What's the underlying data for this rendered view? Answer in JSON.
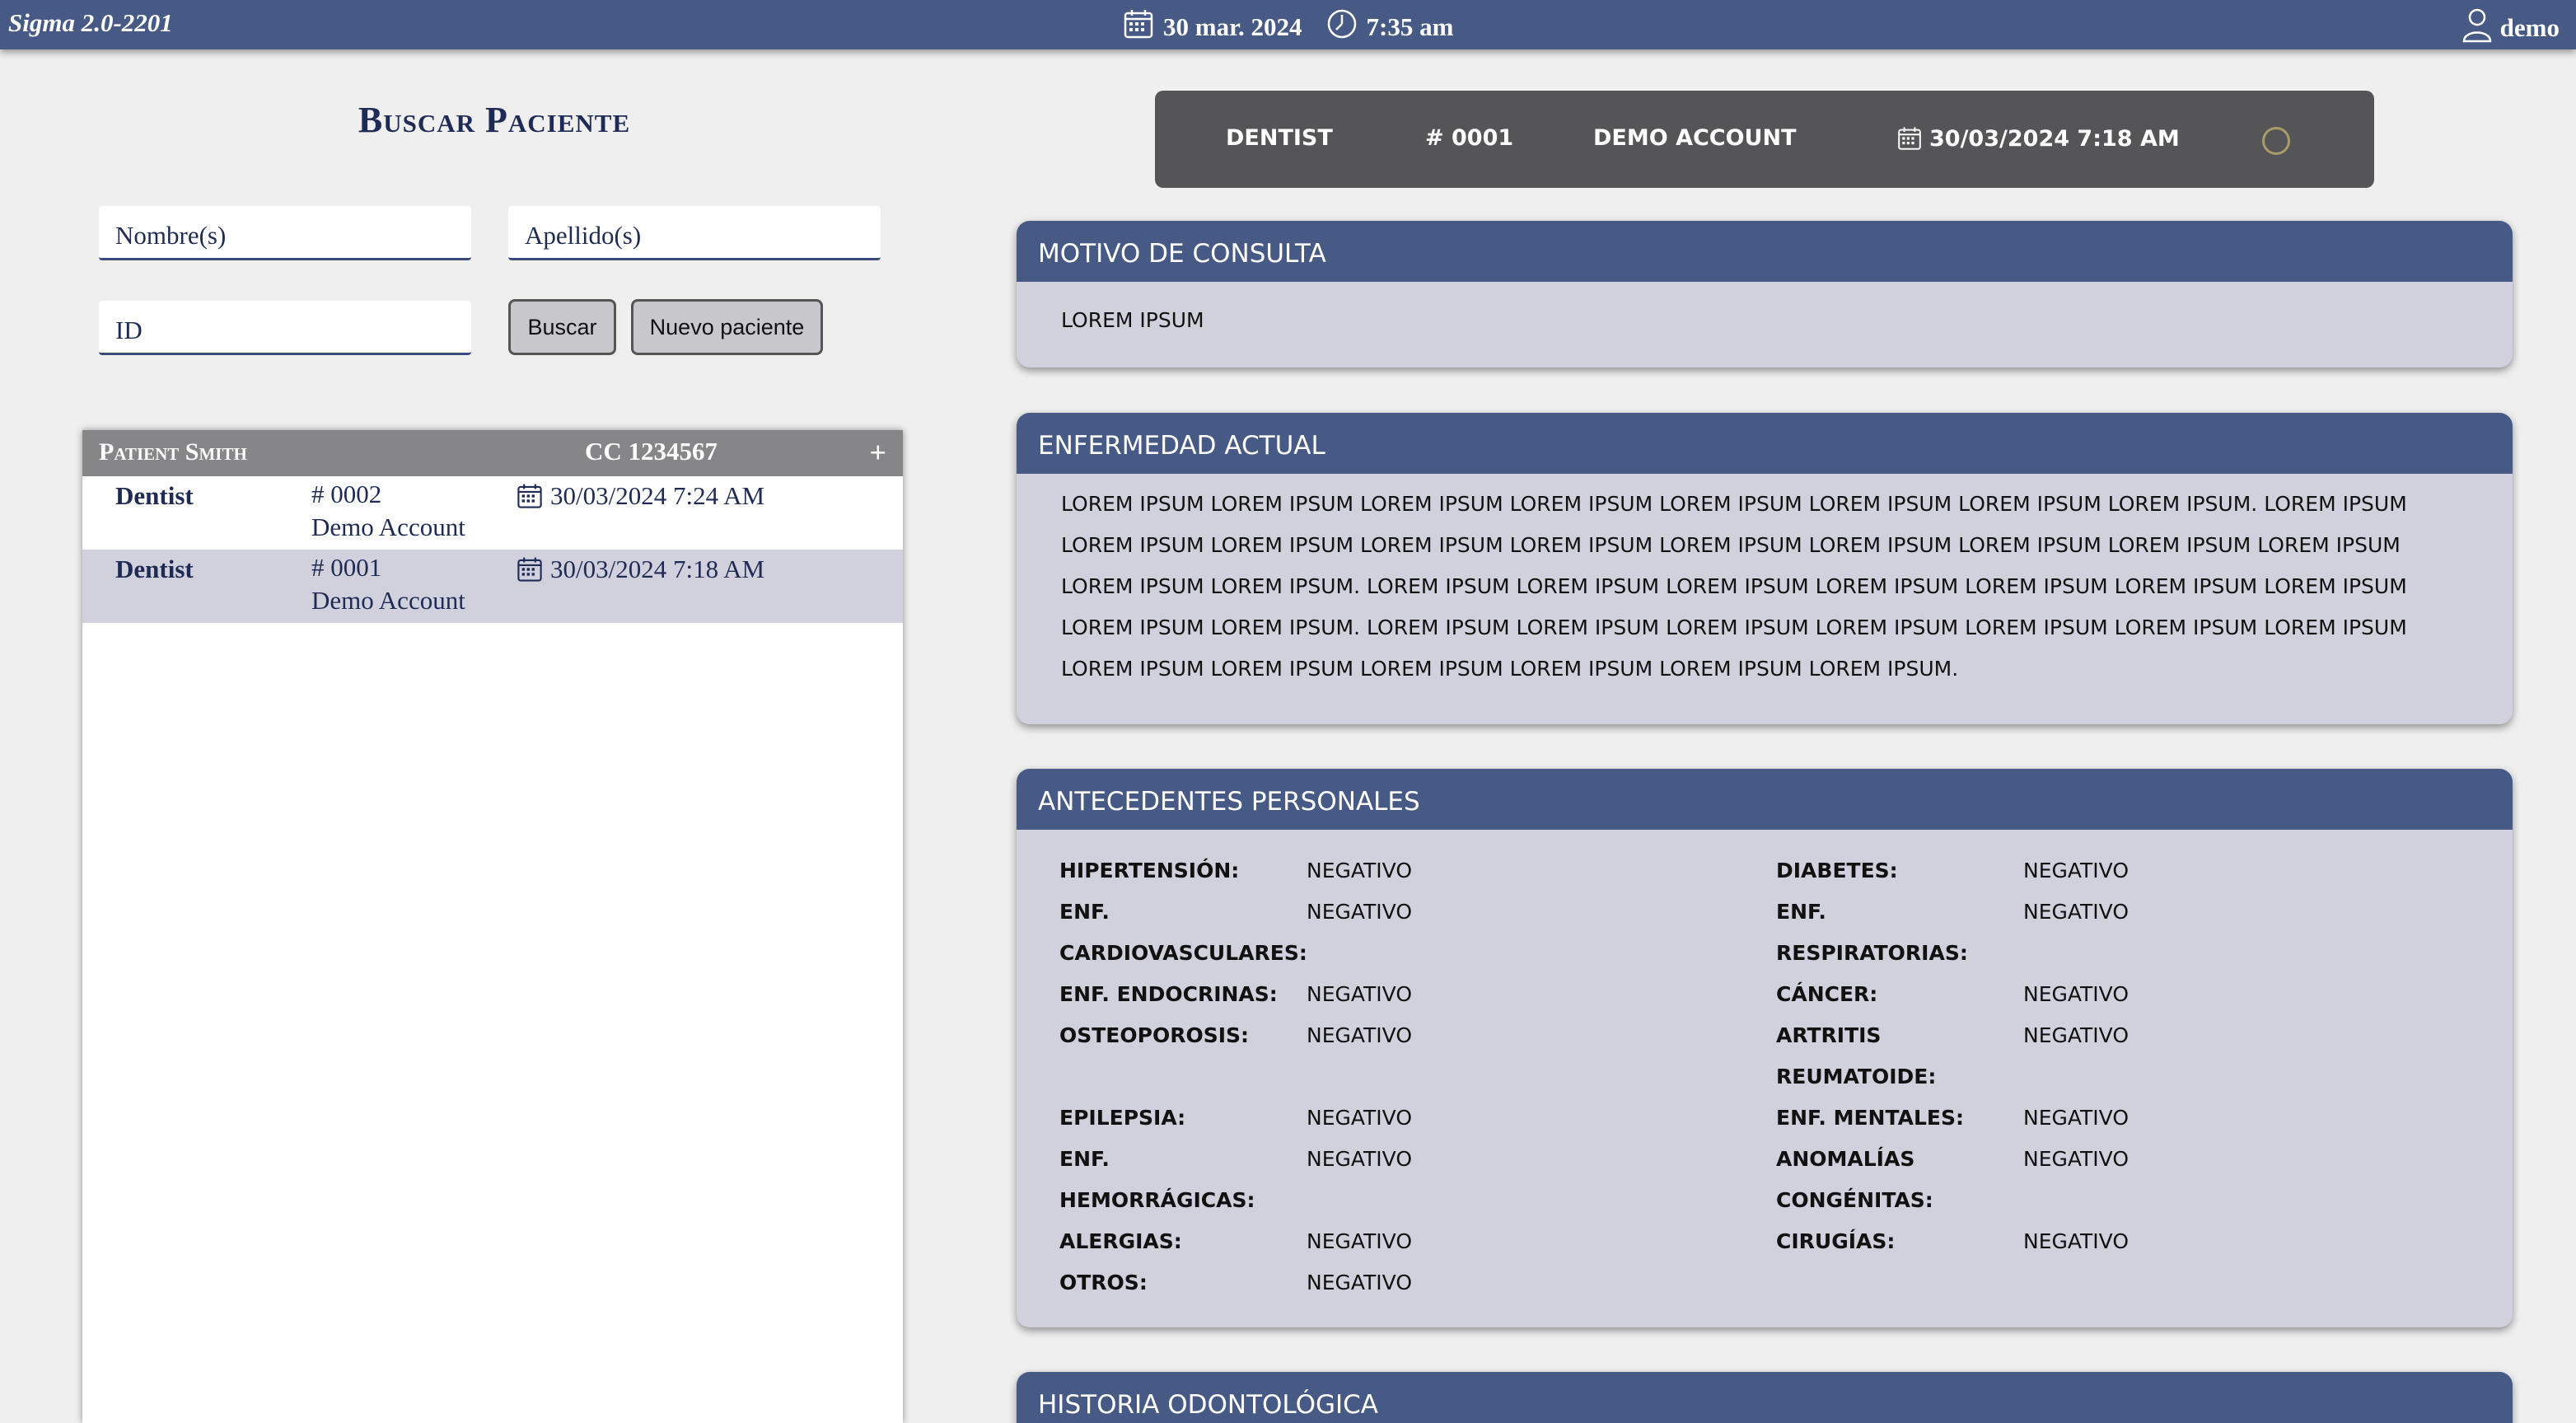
{
  "topbar": {
    "app_title": "Sigma 2.0-2201",
    "date": "30 mar. 2024",
    "time": "7:35 am",
    "user": "demo",
    "bg_color": "#475a85"
  },
  "search": {
    "title": "Buscar Paciente",
    "nombre_placeholder": "Nombre(s)",
    "apellido_placeholder": "Apellido(s)",
    "id_placeholder": "ID",
    "buscar_label": "Buscar",
    "nuevo_label": "Nuevo paciente"
  },
  "patient_list": {
    "patient_name": "Patient Smith",
    "cc": "CC 1234567",
    "add_label": "+",
    "rows": [
      {
        "role": "Dentist",
        "number": "# 0002",
        "account": "Demo Account",
        "date": "30/03/2024 7:24 AM"
      },
      {
        "role": "Dentist",
        "number": "# 0001",
        "account": "Demo Account",
        "date": "30/03/2024 7:18 AM"
      }
    ]
  },
  "visit": {
    "role": "DENTIST",
    "number": "# 0001",
    "account": "DEMO ACCOUNT",
    "date": "30/03/2024 7:18 AM"
  },
  "motivo": {
    "title": "MOTIVO DE CONSULTA",
    "text": "LOREM IPSUM"
  },
  "enfermedad": {
    "title": "ENFERMEDAD ACTUAL",
    "text": "LOREM IPSUM LOREM IPSUM LOREM IPSUM LOREM IPSUM LOREM IPSUM LOREM IPSUM LOREM IPSUM LOREM IPSUM. LOREM IPSUM LOREM IPSUM LOREM IPSUM LOREM IPSUM LOREM IPSUM LOREM IPSUM LOREM IPSUM LOREM IPSUM LOREM IPSUM LOREM IPSUM LOREM IPSUM LOREM IPSUM. LOREM IPSUM LOREM IPSUM LOREM IPSUM LOREM IPSUM LOREM IPSUM LOREM IPSUM LOREM IPSUM LOREM IPSUM LOREM IPSUM. LOREM IPSUM LOREM IPSUM LOREM IPSUM LOREM IPSUM LOREM IPSUM LOREM IPSUM LOREM IPSUM LOREM IPSUM LOREM IPSUM LOREM IPSUM LOREM IPSUM LOREM IPSUM LOREM IPSUM."
  },
  "antecedentes": {
    "title": "ANTECEDENTES PERSONALES",
    "left": [
      {
        "label": "HIPERTENSIÓN:",
        "value": "NEGATIVO"
      },
      {
        "label": "ENF. CARDIOVASCULARES:",
        "value": "NEGATIVO"
      },
      {
        "label": "ENF. ENDOCRINAS:",
        "value": "NEGATIVO"
      },
      {
        "label": "OSTEOPOROSIS:",
        "value": "NEGATIVO"
      },
      {
        "label": "EPILEPSIA:",
        "value": "NEGATIVO"
      },
      {
        "label": "ENF. HEMORRÁGICAS:",
        "value": "NEGATIVO"
      },
      {
        "label": "ALERGIAS:",
        "value": "NEGATIVO"
      },
      {
        "label": "OTROS:",
        "value": "NEGATIVO"
      }
    ],
    "right": [
      {
        "label": "DIABETES:",
        "value": "NEGATIVO"
      },
      {
        "label": "ENF. RESPIRATORIAS:",
        "value": "NEGATIVO"
      },
      {
        "label": "CÁNCER:",
        "value": "NEGATIVO"
      },
      {
        "label": "ARTRITIS REUMATOIDE:",
        "value": "NEGATIVO"
      },
      {
        "label": "ENF. MENTALES:",
        "value": "NEGATIVO"
      },
      {
        "label": "ANOMALÍAS CONGÉNITAS:",
        "value": "NEGATIVO"
      },
      {
        "label": "CIRUGÍAS:",
        "value": "NEGATIVO"
      }
    ]
  },
  "historia": {
    "title": "HISTORIA ODONTOLÓGICA"
  }
}
